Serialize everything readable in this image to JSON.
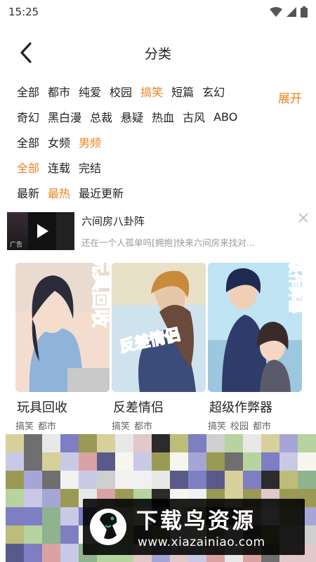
{
  "status": {
    "time": "15:25"
  },
  "header": {
    "title": "分类",
    "back_icon": "chevron-left-icon"
  },
  "filters": {
    "expand_label": "展开",
    "accent_color": "#f0821e",
    "rows": [
      {
        "items": [
          "全部",
          "都市",
          "纯爱",
          "校园",
          "搞笑",
          "短篇",
          "玄幻"
        ],
        "active": 4
      },
      {
        "items": [
          "奇幻",
          "黑白漫",
          "总裁",
          "悬疑",
          "热血",
          "古风",
          "ABO"
        ],
        "active": -1
      },
      {
        "items": [
          "全部",
          "女频",
          "男频"
        ],
        "active": 2
      },
      {
        "items": [
          "全部",
          "连载",
          "完结"
        ],
        "active": 0
      },
      {
        "items": [
          "最新",
          "最热",
          "最近更新"
        ],
        "active": 1
      }
    ]
  },
  "ad": {
    "title": "六间房八卦阵",
    "description": "还在一个人孤单吗[拥抱]快来六间房来找对...",
    "tag": "广告",
    "play_icon": "play-icon",
    "close_icon": "close-icon"
  },
  "comics": [
    {
      "title": "玩具回收",
      "cover_text": "玩具回收",
      "tags": [
        "搞笑",
        "都市"
      ]
    },
    {
      "title": "反差情侣",
      "cover_text": "反差情侣",
      "tags": [
        "搞笑",
        "都市"
      ]
    },
    {
      "title": "超级作弊器",
      "cover_text": "超级作弊器",
      "tags": [
        "搞笑",
        "校园",
        "都市"
      ]
    }
  ],
  "watermark": {
    "brand": "下载鸟资源",
    "url": "www.xiazainiao.com"
  }
}
